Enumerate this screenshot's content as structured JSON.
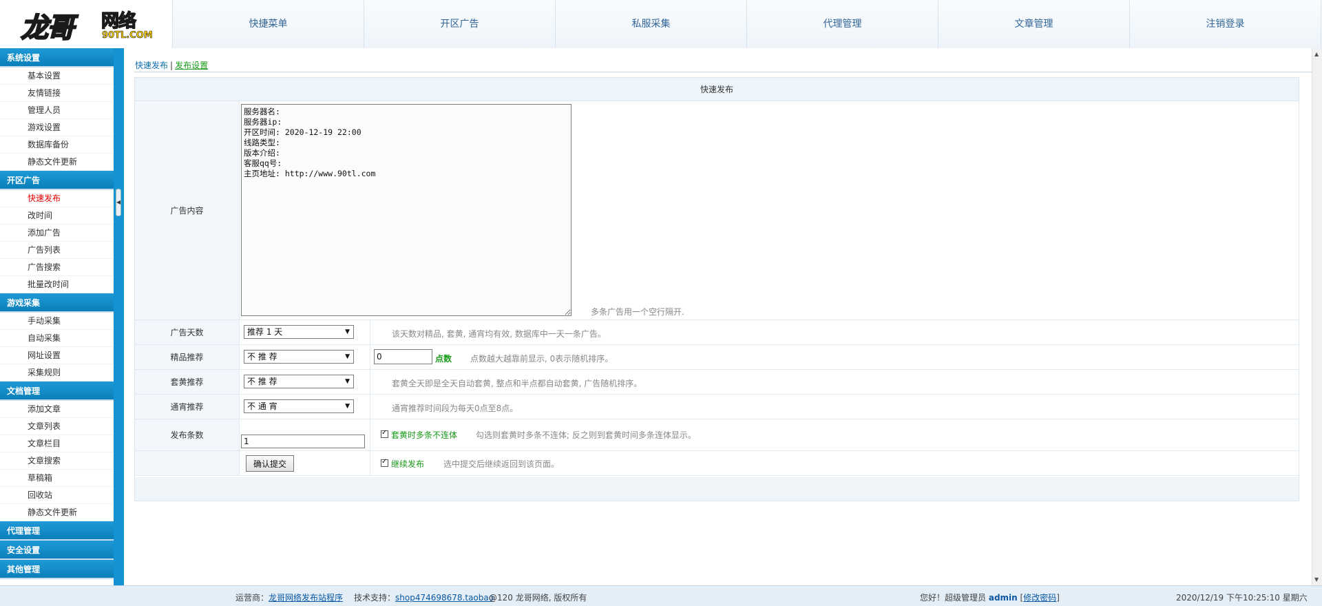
{
  "logo": {
    "main": "龙哥",
    "sub": "网络",
    "domain": "90TL.COM"
  },
  "topnav": [
    {
      "label": "快捷菜单"
    },
    {
      "label": "开区广告"
    },
    {
      "label": "私服采集"
    },
    {
      "label": "代理管理"
    },
    {
      "label": "文章管理"
    },
    {
      "label": "注销登录"
    }
  ],
  "sidebar": {
    "sections": [
      {
        "title": "系统设置",
        "items": [
          "基本设置",
          "友情链接",
          "管理人员",
          "游戏设置",
          "数据库备份",
          "静态文件更新"
        ]
      },
      {
        "title": "开区广告",
        "items": [
          "快速发布",
          "改时间",
          "添加广告",
          "广告列表",
          "广告搜索",
          "批量改时间"
        ]
      },
      {
        "title": "游戏采集",
        "items": [
          "手动采集",
          "自动采集",
          "网址设置",
          "采集规则"
        ]
      },
      {
        "title": "文档管理",
        "items": [
          "添加文章",
          "文章列表",
          "文章栏目",
          "文章搜索",
          "草稿箱",
          "回收站",
          "静态文件更新"
        ]
      },
      {
        "title": "代理管理",
        "items": []
      },
      {
        "title": "安全设置",
        "items": []
      },
      {
        "title": "其他管理",
        "items": []
      }
    ],
    "active_item": "快速发布"
  },
  "breadcrumb": {
    "current": "快速发布",
    "separator": "|",
    "link": "发布设置"
  },
  "form": {
    "title": "快速发布",
    "ad_content": {
      "label": "广告内容",
      "value": "服务器名:\n服务器ip:\n开区时间: 2020-12-19 22:00\n线路类型:\n版本介绍:\n客服qq号:\n主页地址: http://www.90tl.com",
      "hint": "多条广告用一个空行隔开."
    },
    "ad_days": {
      "label": "广告天数",
      "selected": "推荐 1 天",
      "hint": "该天数对精品, 套黄, 通宵均有效, 数据库中一天一条广告。"
    },
    "featured": {
      "label": "精品推荐",
      "selected": "不 推 荐",
      "points_value": "0",
      "points_label": "点数",
      "hint": "点数越大越靠前显示, 0表示随机排序。"
    },
    "yellow": {
      "label": "套黄推荐",
      "selected": "不 推 荐",
      "hint": "套黄全天即是全天自动套黄, 整点和半点都自动套黄, 广告随机排序。"
    },
    "overnight": {
      "label": "通宵推荐",
      "selected": "不 通 宵",
      "hint": "通宵推荐时间段为每天0点至8点。"
    },
    "count": {
      "label": "发布条数",
      "value": "1",
      "checkbox_label": "套黄时多条不连体",
      "hint": "勾选则套黄时多条不连体; 反之则到套黄时间多条连体显示。"
    },
    "submit": {
      "button": "确认提交",
      "checkbox_label": "继续发布",
      "hint": "选中提交后继续返回到该页面。"
    }
  },
  "footer": {
    "operator_label": "运营商：",
    "operator_link": "龙哥网络发布站程序",
    "support_label": "技术支持：",
    "support_link": "shop474698678.taobao",
    "copyright": "@120 龙哥网络, 版权所有",
    "greeting": "您好！超级管理员",
    "admin": "admin",
    "bracket_open": "[",
    "change_pwd": "修改密码",
    "bracket_close": "]",
    "datetime": "2020/12/19 下午10:25:10 星期六"
  }
}
